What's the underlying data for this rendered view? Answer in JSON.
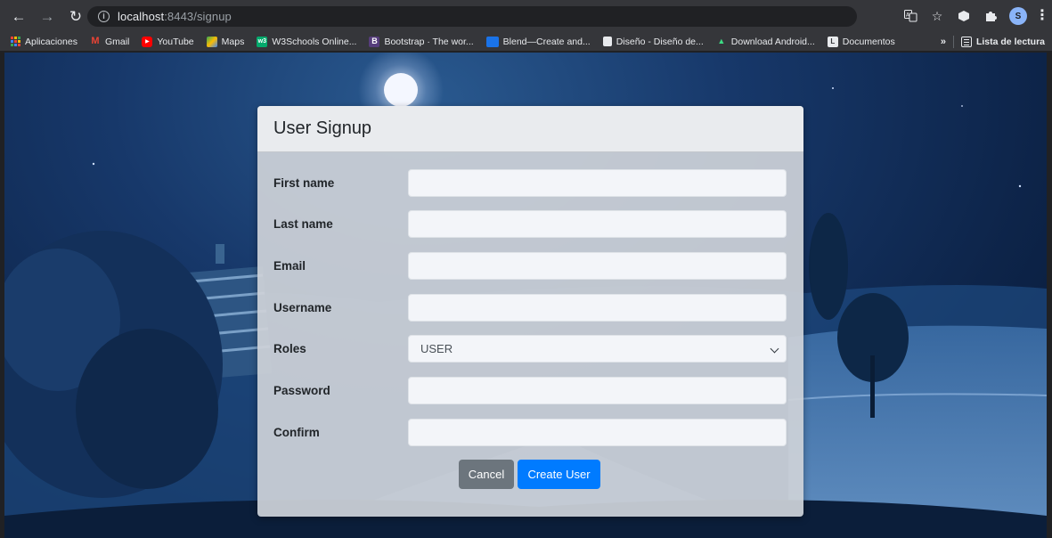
{
  "browser": {
    "url_host": "localhost",
    "url_rest": ":8443/signup",
    "profile_initial": "S",
    "icons": [
      "back-icon",
      "forward-icon",
      "reload-icon",
      "info-icon",
      "translate-icon",
      "star-icon",
      "extension-cube-icon",
      "puzzle-icon",
      "profile-avatar",
      "menu-icon"
    ]
  },
  "bookmarks": {
    "items": [
      {
        "label": "Aplicaciones",
        "icon": "apps-grid-icon"
      },
      {
        "label": "Gmail",
        "icon": "gmail-icon",
        "color": "#ea4335",
        "glyph": "M"
      },
      {
        "label": "YouTube",
        "icon": "youtube-icon",
        "color": "#ff0000",
        "glyph": "▶"
      },
      {
        "label": "Maps",
        "icon": "maps-icon",
        "color": "#34a853",
        "glyph": "◆"
      },
      {
        "label": "W3Schools Online...",
        "icon": "w3schools-icon",
        "color": "#04aa6d",
        "glyph": "w3"
      },
      {
        "label": "Bootstrap · The wor...",
        "icon": "bootstrap-icon",
        "color": "#563d7c",
        "glyph": "B"
      },
      {
        "label": "Blend—Create and...",
        "icon": "blend-icon",
        "color": "#1a73e8",
        "glyph": ""
      },
      {
        "label": "Diseño - Diseño de...",
        "icon": "page-icon",
        "color": "#e8eaed",
        "glyph": ""
      },
      {
        "label": "Download Android...",
        "icon": "android-icon",
        "color": "#3ddc84",
        "glyph": "▲"
      },
      {
        "label": "Documentos",
        "icon": "documentos-icon",
        "color": "#e8eaed",
        "glyph": "L"
      }
    ],
    "more": "»",
    "reading_list": "Lista de lectura"
  },
  "form": {
    "title": "User Signup",
    "fields": {
      "first_name": {
        "label": "First name",
        "value": ""
      },
      "last_name": {
        "label": "Last name",
        "value": ""
      },
      "email": {
        "label": "Email",
        "value": ""
      },
      "username": {
        "label": "Username",
        "value": ""
      },
      "roles": {
        "label": "Roles",
        "selected": "USER"
      },
      "password": {
        "label": "Password",
        "value": ""
      },
      "confirm": {
        "label": "Confirm",
        "value": ""
      }
    },
    "buttons": {
      "cancel": "Cancel",
      "create": "Create User"
    }
  },
  "colors": {
    "primary": "#007bff",
    "secondary": "#6c757d",
    "chrome_toolbar": "#35363a"
  }
}
